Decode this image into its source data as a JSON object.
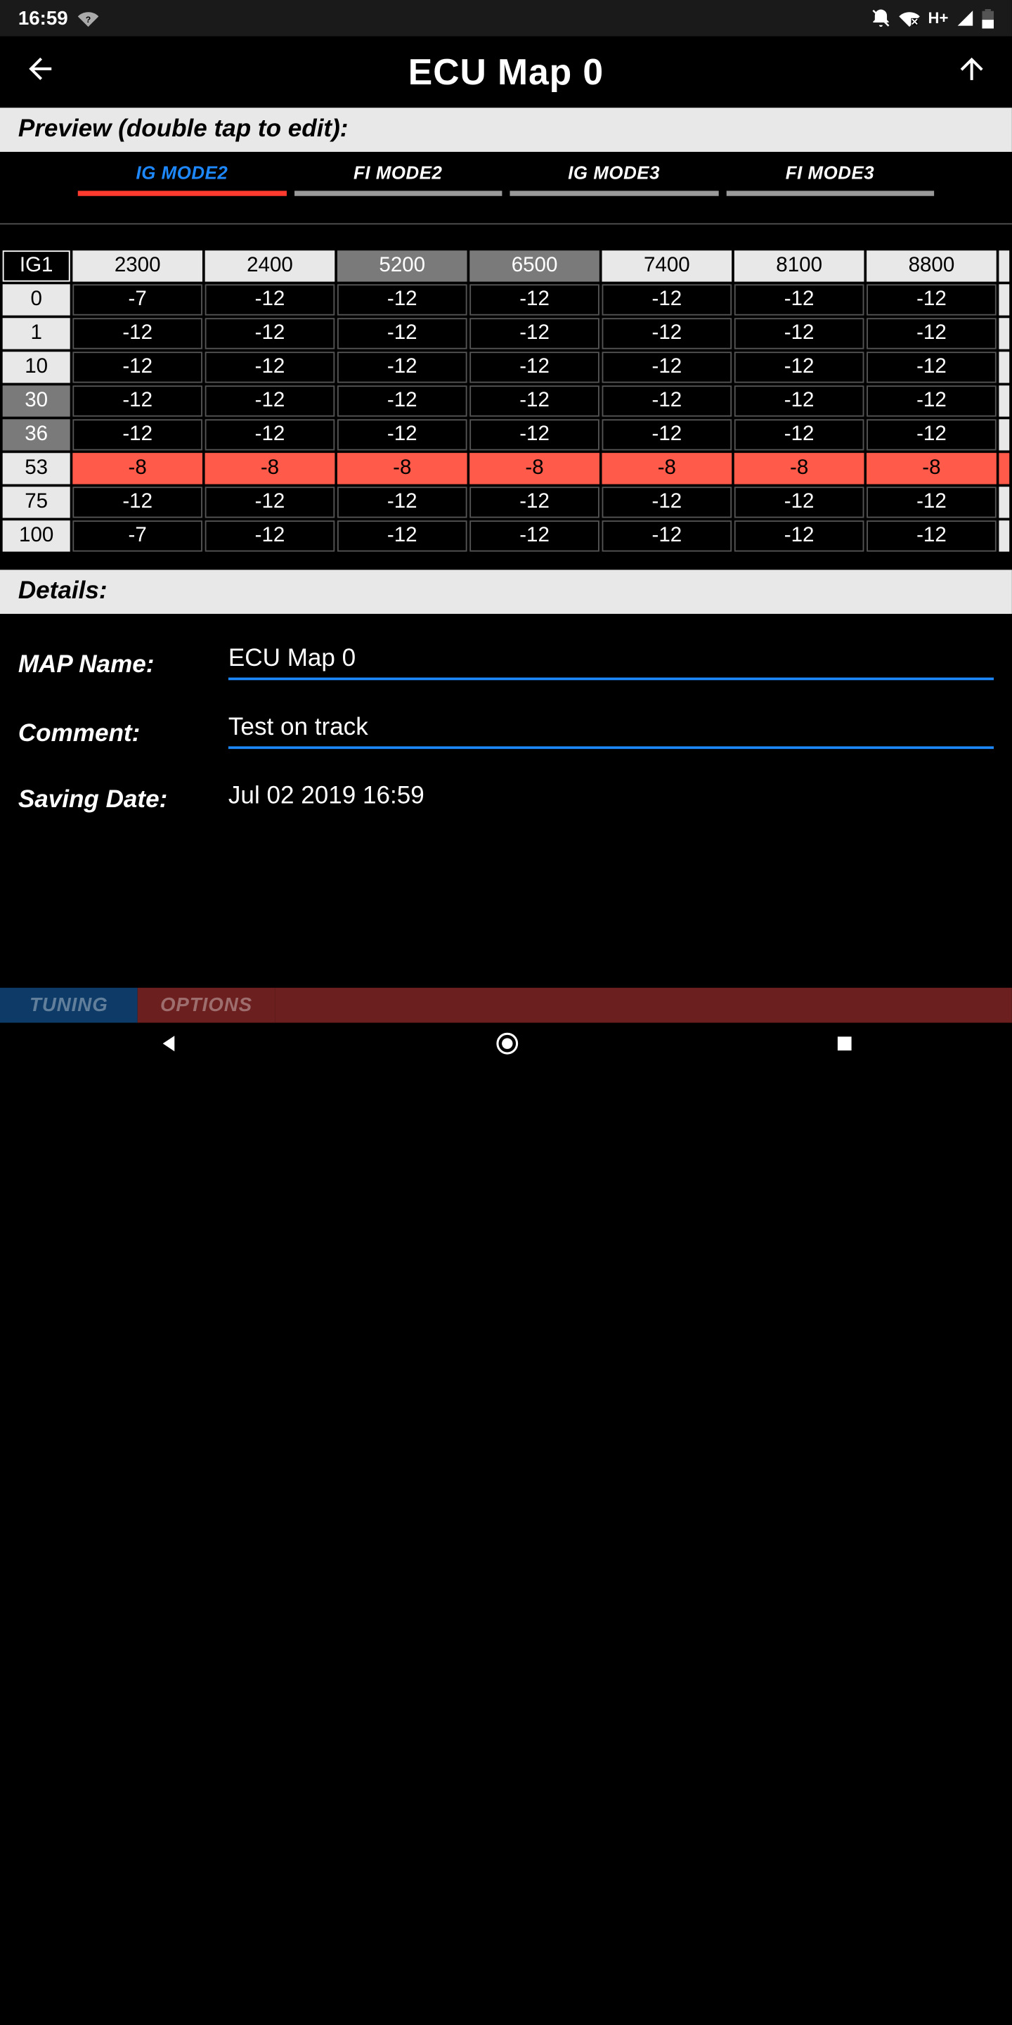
{
  "status": {
    "time": "16:59",
    "network": "H+"
  },
  "header": {
    "title": "ECU Map 0"
  },
  "sections": {
    "preview": "Preview (double tap to edit):",
    "details": "Details:"
  },
  "tabs": [
    "IG MODE2",
    "FI MODE2",
    "IG MODE3",
    "FI MODE3"
  ],
  "active_tab": 0,
  "table": {
    "corner": "IG1",
    "cols": [
      "2300",
      "2400",
      "5200",
      "6500",
      "7400",
      "8100",
      "8800"
    ],
    "col_selected": [
      false,
      false,
      true,
      true,
      false,
      false,
      false
    ],
    "rows": [
      "0",
      "1",
      "10",
      "30",
      "36",
      "53",
      "75",
      "100"
    ],
    "row_selected": [
      false,
      false,
      false,
      true,
      true,
      false,
      false,
      false
    ],
    "row_highlight": [
      false,
      false,
      false,
      false,
      false,
      true,
      false,
      false
    ],
    "cells": [
      [
        "-7",
        "-12",
        "-12",
        "-12",
        "-12",
        "-12",
        "-12"
      ],
      [
        "-12",
        "-12",
        "-12",
        "-12",
        "-12",
        "-12",
        "-12"
      ],
      [
        "-12",
        "-12",
        "-12",
        "-12",
        "-12",
        "-12",
        "-12"
      ],
      [
        "-12",
        "-12",
        "-12",
        "-12",
        "-12",
        "-12",
        "-12"
      ],
      [
        "-12",
        "-12",
        "-12",
        "-12",
        "-12",
        "-12",
        "-12"
      ],
      [
        "-8",
        "-8",
        "-8",
        "-8",
        "-8",
        "-8",
        "-8"
      ],
      [
        "-12",
        "-12",
        "-12",
        "-12",
        "-12",
        "-12",
        "-12"
      ],
      [
        "-7",
        "-12",
        "-12",
        "-12",
        "-12",
        "-12",
        "-12"
      ]
    ]
  },
  "details": {
    "map_name_label": "MAP Name:",
    "map_name": "ECU Map 0",
    "comment_label": "Comment:",
    "comment": "Test on track",
    "date_label": "Saving Date:",
    "date": "Jul 02 2019 16:59"
  },
  "bottom_tabs": {
    "tuning": "TUNING",
    "options": "OPTIONS"
  }
}
